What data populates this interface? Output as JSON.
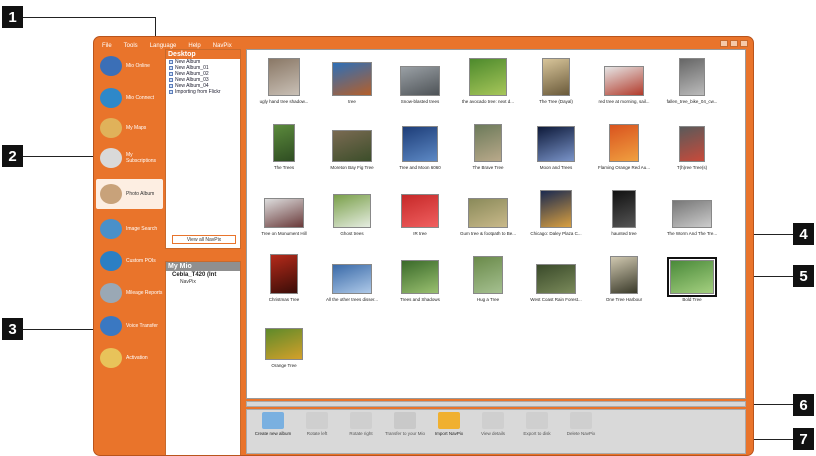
{
  "callouts": [
    "1",
    "2",
    "3",
    "4",
    "5",
    "6",
    "7"
  ],
  "menu": [
    "File",
    "Tools",
    "Language",
    "Help",
    "NavPix"
  ],
  "nav": [
    {
      "label": "Mio Online",
      "color": "#3b6fb7"
    },
    {
      "label": "Mio Connect",
      "color": "#2e88c9"
    },
    {
      "label": "My Maps",
      "color": "#e0b25a"
    },
    {
      "label": "My Subscriptions",
      "color": "#d9d9d9"
    },
    {
      "label": "Photo Album",
      "color": "#c8a27a",
      "active": true
    },
    {
      "label": "Image Search",
      "color": "#4a90c9"
    },
    {
      "label": "Custom POIs",
      "color": "#2b7fc4"
    },
    {
      "label": "Mileage Reports",
      "color": "#9aa8b5"
    },
    {
      "label": "Voice Transfer",
      "color": "#3a78c2"
    },
    {
      "label": "Activation",
      "color": "#e8c35a"
    }
  ],
  "desktop": {
    "title": "Desktop",
    "items": [
      "New Album",
      "New Album_01",
      "New Album_02",
      "New Album_03",
      "New Album_04",
      "Importing from Flickr"
    ],
    "view_all": "View all NavPix"
  },
  "mymio": {
    "title": "My Mio",
    "device": "Cebla_T420 (Int",
    "navpix": "NavPix"
  },
  "thumbnails": [
    {
      "caption": "ugly hand tree shadow...",
      "c1": "#8a7866",
      "c2": "#c9c0b6"
    },
    {
      "caption": "tree",
      "c1": "#2d6fb8",
      "c2": "#b55f2a"
    },
    {
      "caption": "Snow-blasted trees",
      "c1": "#9aa0a5",
      "c2": "#4e5357"
    },
    {
      "caption": "the avocado tree: next d...",
      "c1": "#4d8a2c",
      "c2": "#a7c65a"
    },
    {
      "caption": "The Tree (Dayal)",
      "c1": "#d8c59a",
      "c2": "#6a5a3a"
    },
    {
      "caption": "red tree at morning, sail...",
      "c1": "#e5e5e5",
      "c2": "#b23a2a"
    },
    {
      "caption": "fallen_tree_bike_04_cw...",
      "c1": "#666",
      "c2": "#bbb"
    },
    {
      "caption": "The Trees",
      "c1": "#5b8a3c",
      "c2": "#2f4d22"
    },
    {
      "caption": "Moreton Bay Fig Tree",
      "c1": "#7a6a52",
      "c2": "#3c4e2a"
    },
    {
      "caption": "Tree and Moon 6060",
      "c1": "#1d3d78",
      "c2": "#5d89c5"
    },
    {
      "caption": "The Brave Tree",
      "c1": "#6c7a5a",
      "c2": "#b9a98a"
    },
    {
      "caption": "Moon and Trees",
      "c1": "#0e1a3a",
      "c2": "#7a94c9"
    },
    {
      "caption": "Flaming Orange Red Au...",
      "c1": "#d9531e",
      "c2": "#f0a040"
    },
    {
      "caption": "T(h)ree Tree(s)",
      "c1": "#5a5a5a",
      "c2": "#c94a3a"
    },
    {
      "caption": "Tree on Monument Hill",
      "c1": "#ddd",
      "c2": "#6a3a3a"
    },
    {
      "caption": "Ghost trees",
      "c1": "#7aa04a",
      "c2": "#e5ece0"
    },
    {
      "caption": "IR tree",
      "c1": "#c62828",
      "c2": "#f06060"
    },
    {
      "caption": "Gum tree & footpath to Be...",
      "c1": "#8a8a5a",
      "c2": "#c9b98a"
    },
    {
      "caption": "Chicago: Daley Plaza C...",
      "c1": "#1a2a50",
      "c2": "#d9a040"
    },
    {
      "caption": "haunted tree",
      "c1": "#111",
      "c2": "#555"
    },
    {
      "caption": "The Worm And The Tre...",
      "c1": "#777",
      "c2": "#ccc"
    },
    {
      "caption": "Christmas Tree",
      "c1": "#b52a1a",
      "c2": "#3a0d08"
    },
    {
      "caption": "All the other trees disser...",
      "c1": "#3a6aa8",
      "c2": "#aec9e8"
    },
    {
      "caption": "Trees and Shadows",
      "c1": "#3a6a2a",
      "c2": "#9ac070"
    },
    {
      "caption": "Hug a Tree",
      "c1": "#6a8a4a",
      "c2": "#a5c090"
    },
    {
      "caption": "West Coast Rain Forest...",
      "c1": "#3a4a2a",
      "c2": "#7a8a5a"
    },
    {
      "caption": "One Tree Harbour",
      "c1": "#d0c8b0",
      "c2": "#3a3a2a"
    },
    {
      "caption": "Bold Tree",
      "c1": "#4a8a3a",
      "c2": "#a5d080",
      "selected": true
    },
    {
      "caption": "Orange Tree",
      "c1": "#5e8a2a",
      "c2": "#d4a02a"
    }
  ],
  "toolbar": [
    {
      "label": "Create new album",
      "color": "#7ab0e0",
      "enabled": true
    },
    {
      "label": "Rotate left",
      "color": "#cfcfcf",
      "enabled": false
    },
    {
      "label": "Rotate right",
      "color": "#cfcfcf",
      "enabled": false
    },
    {
      "label": "Transfer to your Mio",
      "color": "#c9c9c9",
      "enabled": false
    },
    {
      "label": "Import NavPix",
      "color": "#f0b030",
      "enabled": true
    },
    {
      "label": "View details",
      "color": "#cfcfcf",
      "enabled": false
    },
    {
      "label": "Export to disk",
      "color": "#cfcfcf",
      "enabled": false
    },
    {
      "label": "Delete NavPix",
      "color": "#cfcfcf",
      "enabled": false
    }
  ]
}
